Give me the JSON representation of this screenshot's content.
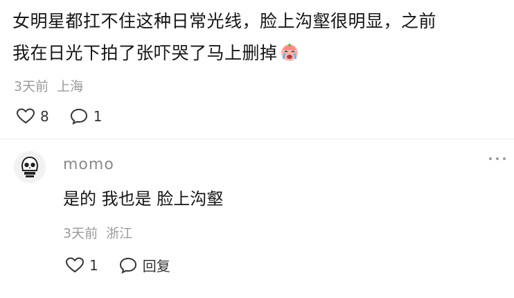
{
  "main_comment": {
    "line1": "女明星都扛不住这种日常光线，脸上沟壑很明显，之前",
    "line2": "我在日光下拍了张吓哭了马上删掉",
    "emoji": "crying-face-emoji",
    "time": "3天前",
    "location": "上海",
    "like_count": "8",
    "comment_count": "1"
  },
  "reply": {
    "username": "momo",
    "text": "是的 我也是 脸上沟壑",
    "time": "3天前",
    "location": "浙江",
    "like_count": "1",
    "reply_label": "回复"
  }
}
